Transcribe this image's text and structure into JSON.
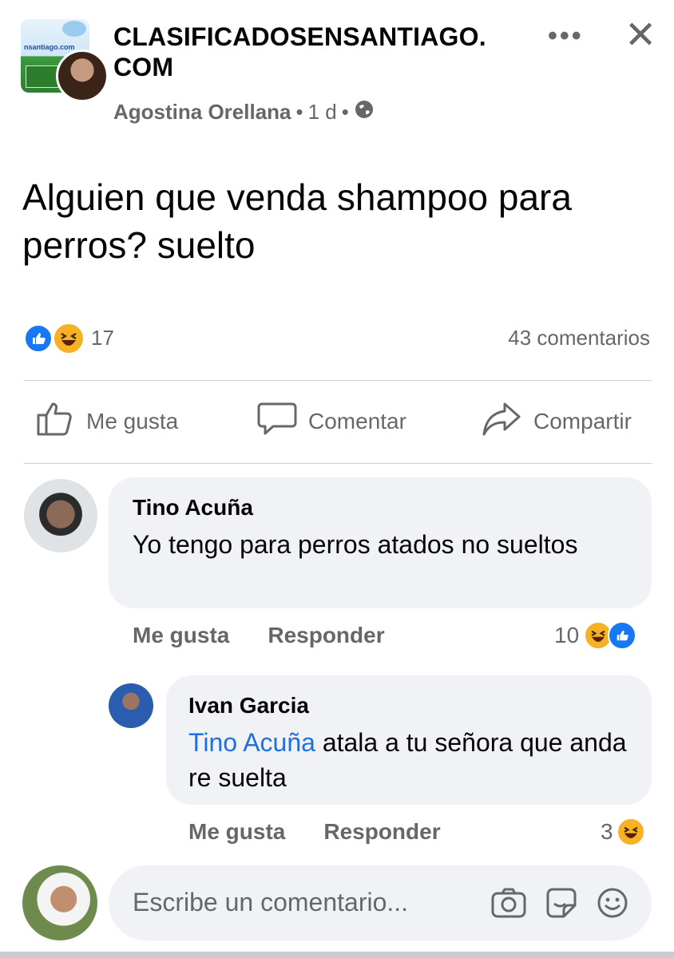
{
  "header": {
    "group_name": "CLASIFICADOSENSANTIAGO.\nCOM",
    "group_thumb_text": "nsantiago.com",
    "author": "Agostina Orellana",
    "separator": "•",
    "time": "1 d",
    "more_label": "•••",
    "close_label": "✕"
  },
  "post": {
    "text": "Alguien que venda shampoo para perros? suelto",
    "reaction_count": "17",
    "comment_count": "43 comentarios"
  },
  "actions": {
    "like": "Me gusta",
    "comment": "Comentar",
    "share": "Compartir"
  },
  "comments": [
    {
      "name": "Tino Acuña",
      "text": "Yo tengo para perros atados no sueltos",
      "like_label": "Me gusta",
      "reply_label": "Responder",
      "reaction_count": "10"
    },
    {
      "name": "Ivan Garcia",
      "mention": "Tino Acuña",
      "text": " atala a tu señora que anda re suelta",
      "like_label": "Me gusta",
      "reply_label": "Responder",
      "reaction_count": "3"
    }
  ],
  "composer": {
    "placeholder": "Escribe un comentario..."
  },
  "colors": {
    "like_blue": "#1877f2",
    "haha_yellow": "#f7b125",
    "secondary_text": "#65676b",
    "bubble_bg": "#f0f2f5",
    "mention": "#216fdb"
  }
}
